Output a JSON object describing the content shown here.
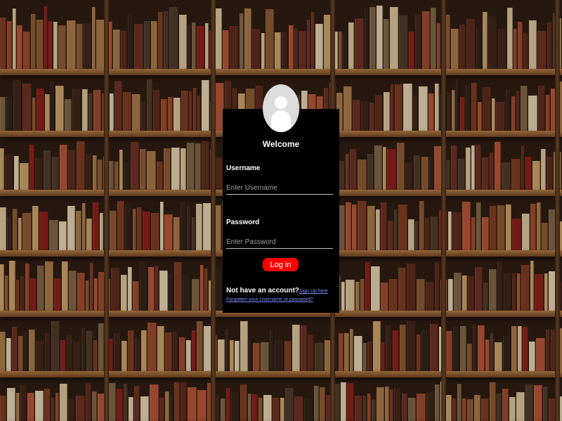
{
  "login": {
    "welcome": "Welcome",
    "username_label": "Username",
    "username_placeholder": "Enter Username",
    "username_value": "",
    "password_label": "Password",
    "password_placeholder": "Enter Password",
    "password_value": "",
    "login_button": "Log in",
    "no_account_text": "Not have an account?",
    "signup_link": "Sign Up here",
    "forgot_link": "Forgotten your Username or password?"
  },
  "colors": {
    "card_background": "#000000",
    "button": "#ff0000",
    "link": "#7b8cff",
    "avatar": "#dcdcdc"
  },
  "icons": {
    "avatar": "user-silhouette-icon"
  }
}
